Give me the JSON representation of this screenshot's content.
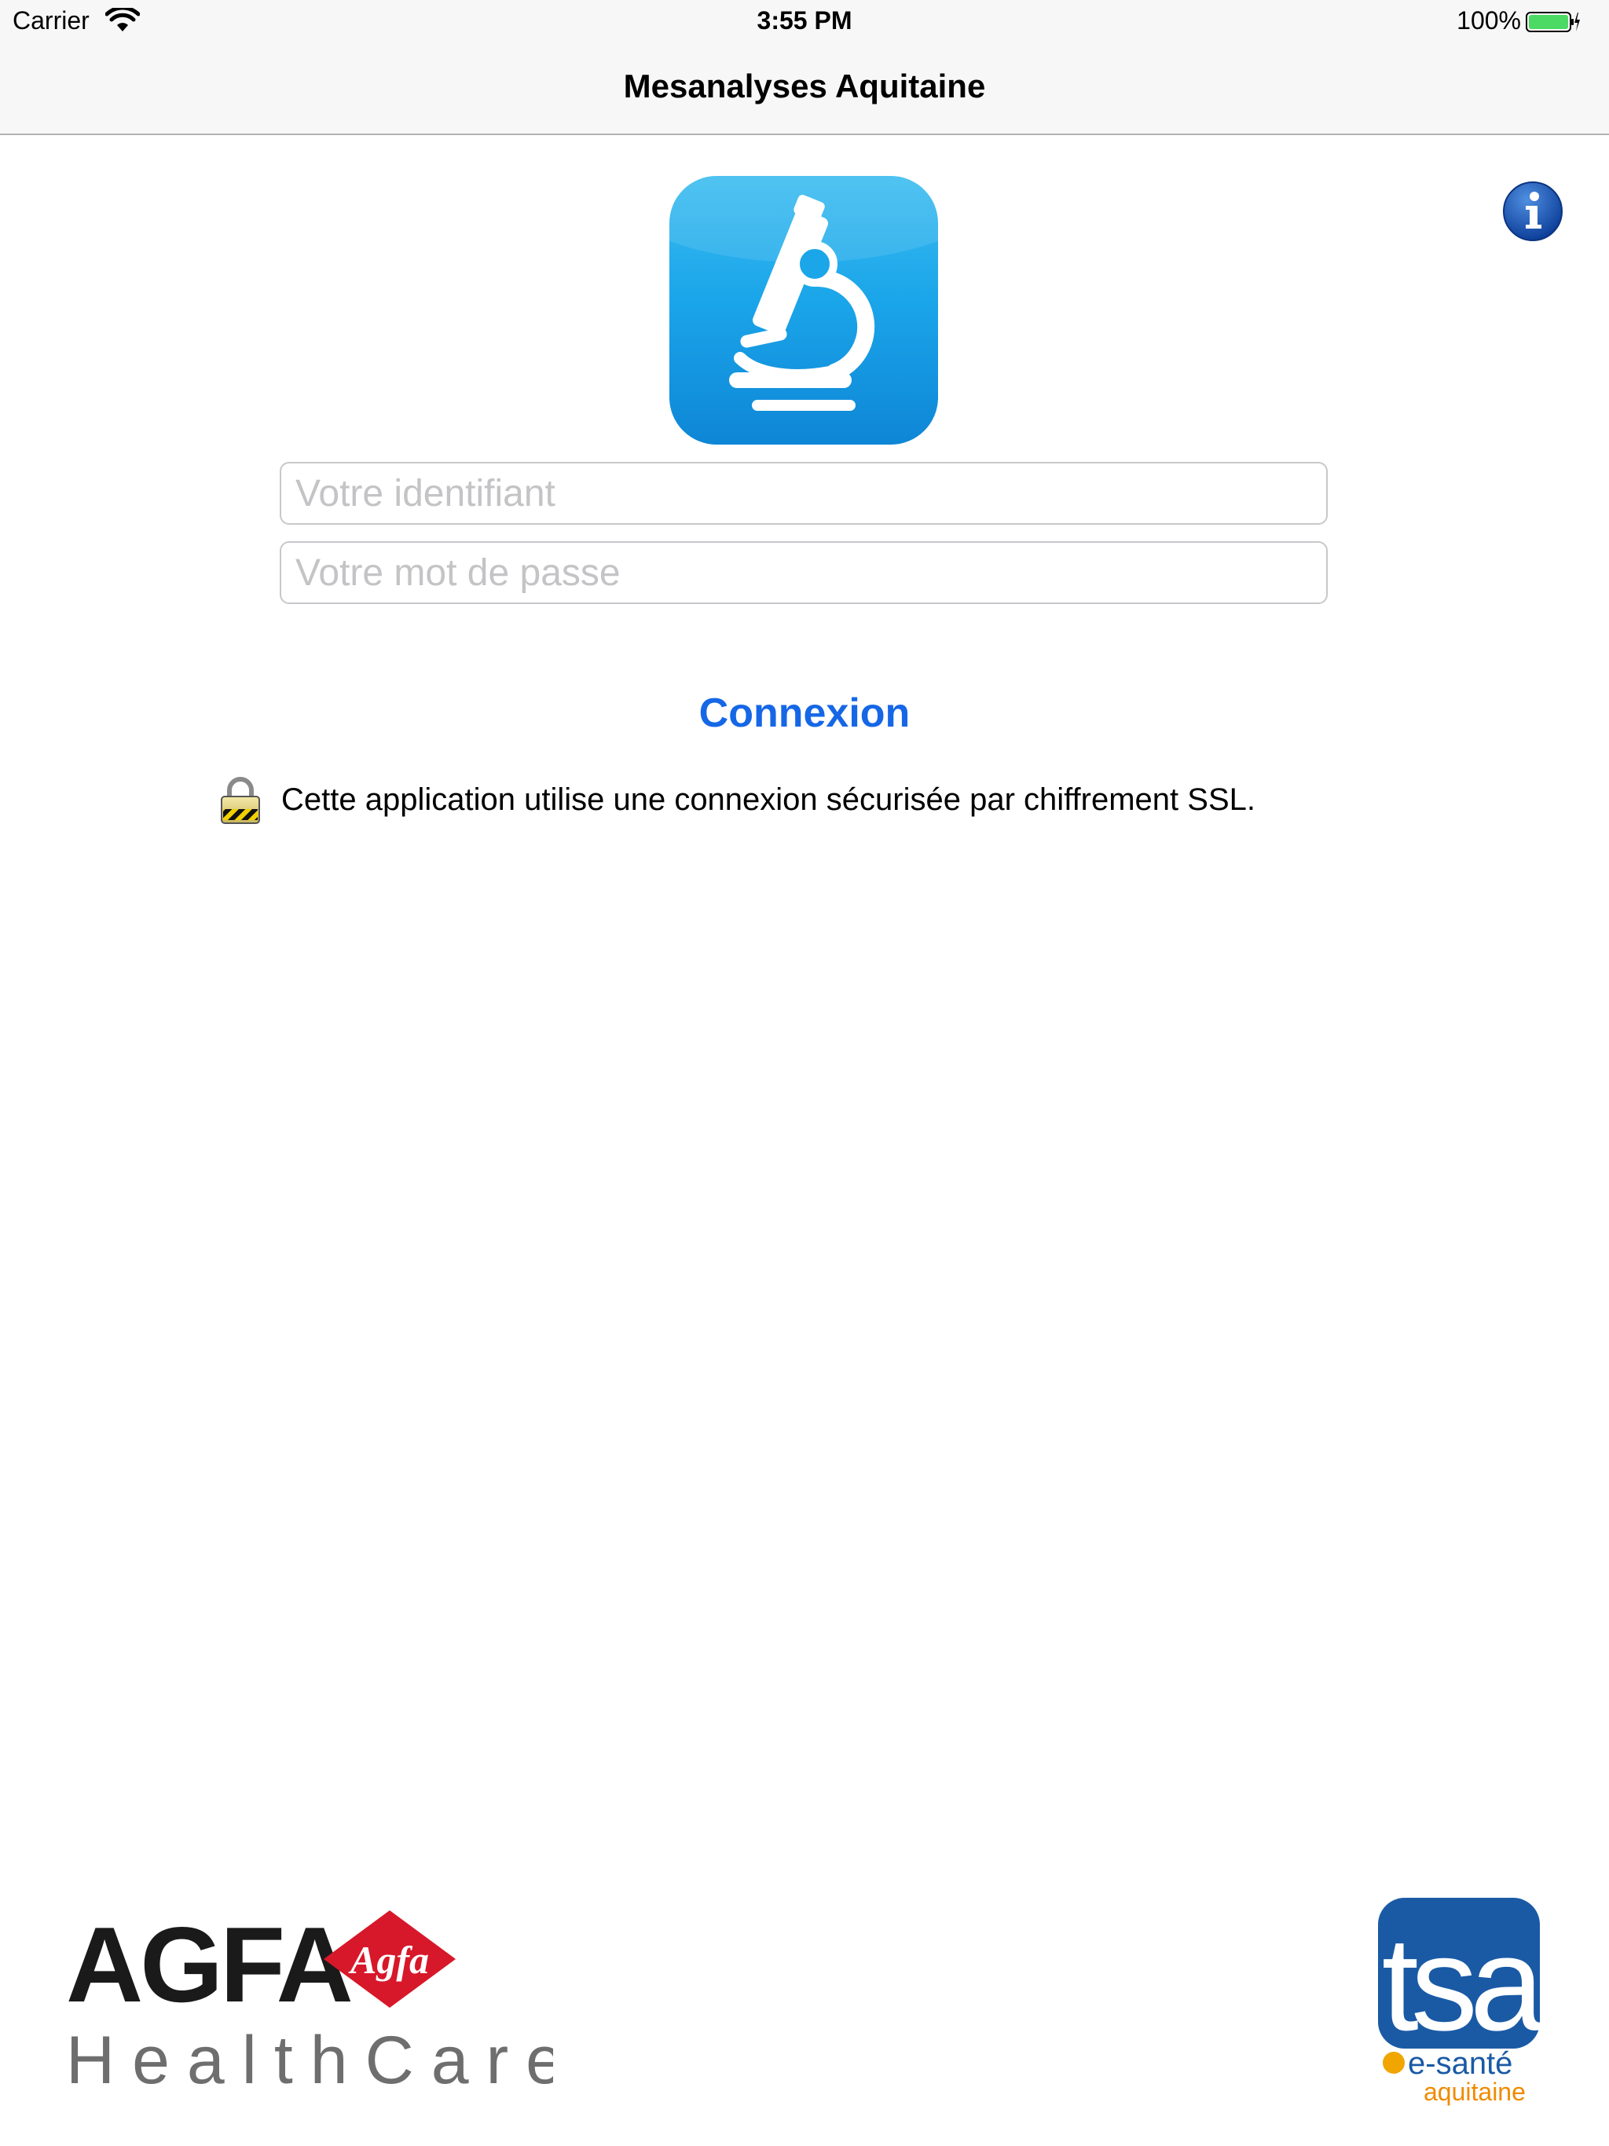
{
  "status_bar": {
    "carrier": "Carrier",
    "time": "3:55 PM",
    "battery_percent": "100%",
    "battery_level": 1.0
  },
  "nav": {
    "title": "Mesanalyses Aquitaine"
  },
  "icons": {
    "info": "info-icon",
    "app": "microscope-icon",
    "lock": "lock-icon"
  },
  "login": {
    "username_placeholder": "Votre identifiant",
    "username_value": "",
    "password_placeholder": "Votre mot de passe",
    "password_value": "",
    "connect_label": "Connexion"
  },
  "security_note": "Cette application utilise une connexion sécurisée par chiffrement SSL.",
  "logos": {
    "agfa": {
      "wordmark": "AGFA",
      "badge": "Agfa",
      "subtitle": "HealthCare"
    },
    "tsa": {
      "wordmark": "tsa",
      "line1": "e-santé",
      "line2": "aquitaine"
    }
  },
  "colors": {
    "accent": "#1667e6",
    "app_icon_blue": "#1ba6ea",
    "agfa_red": "#d7182a",
    "tsa_blue": "#1a5aa5",
    "tsa_orange": "#f08a00",
    "battery_green": "#4cd964"
  }
}
